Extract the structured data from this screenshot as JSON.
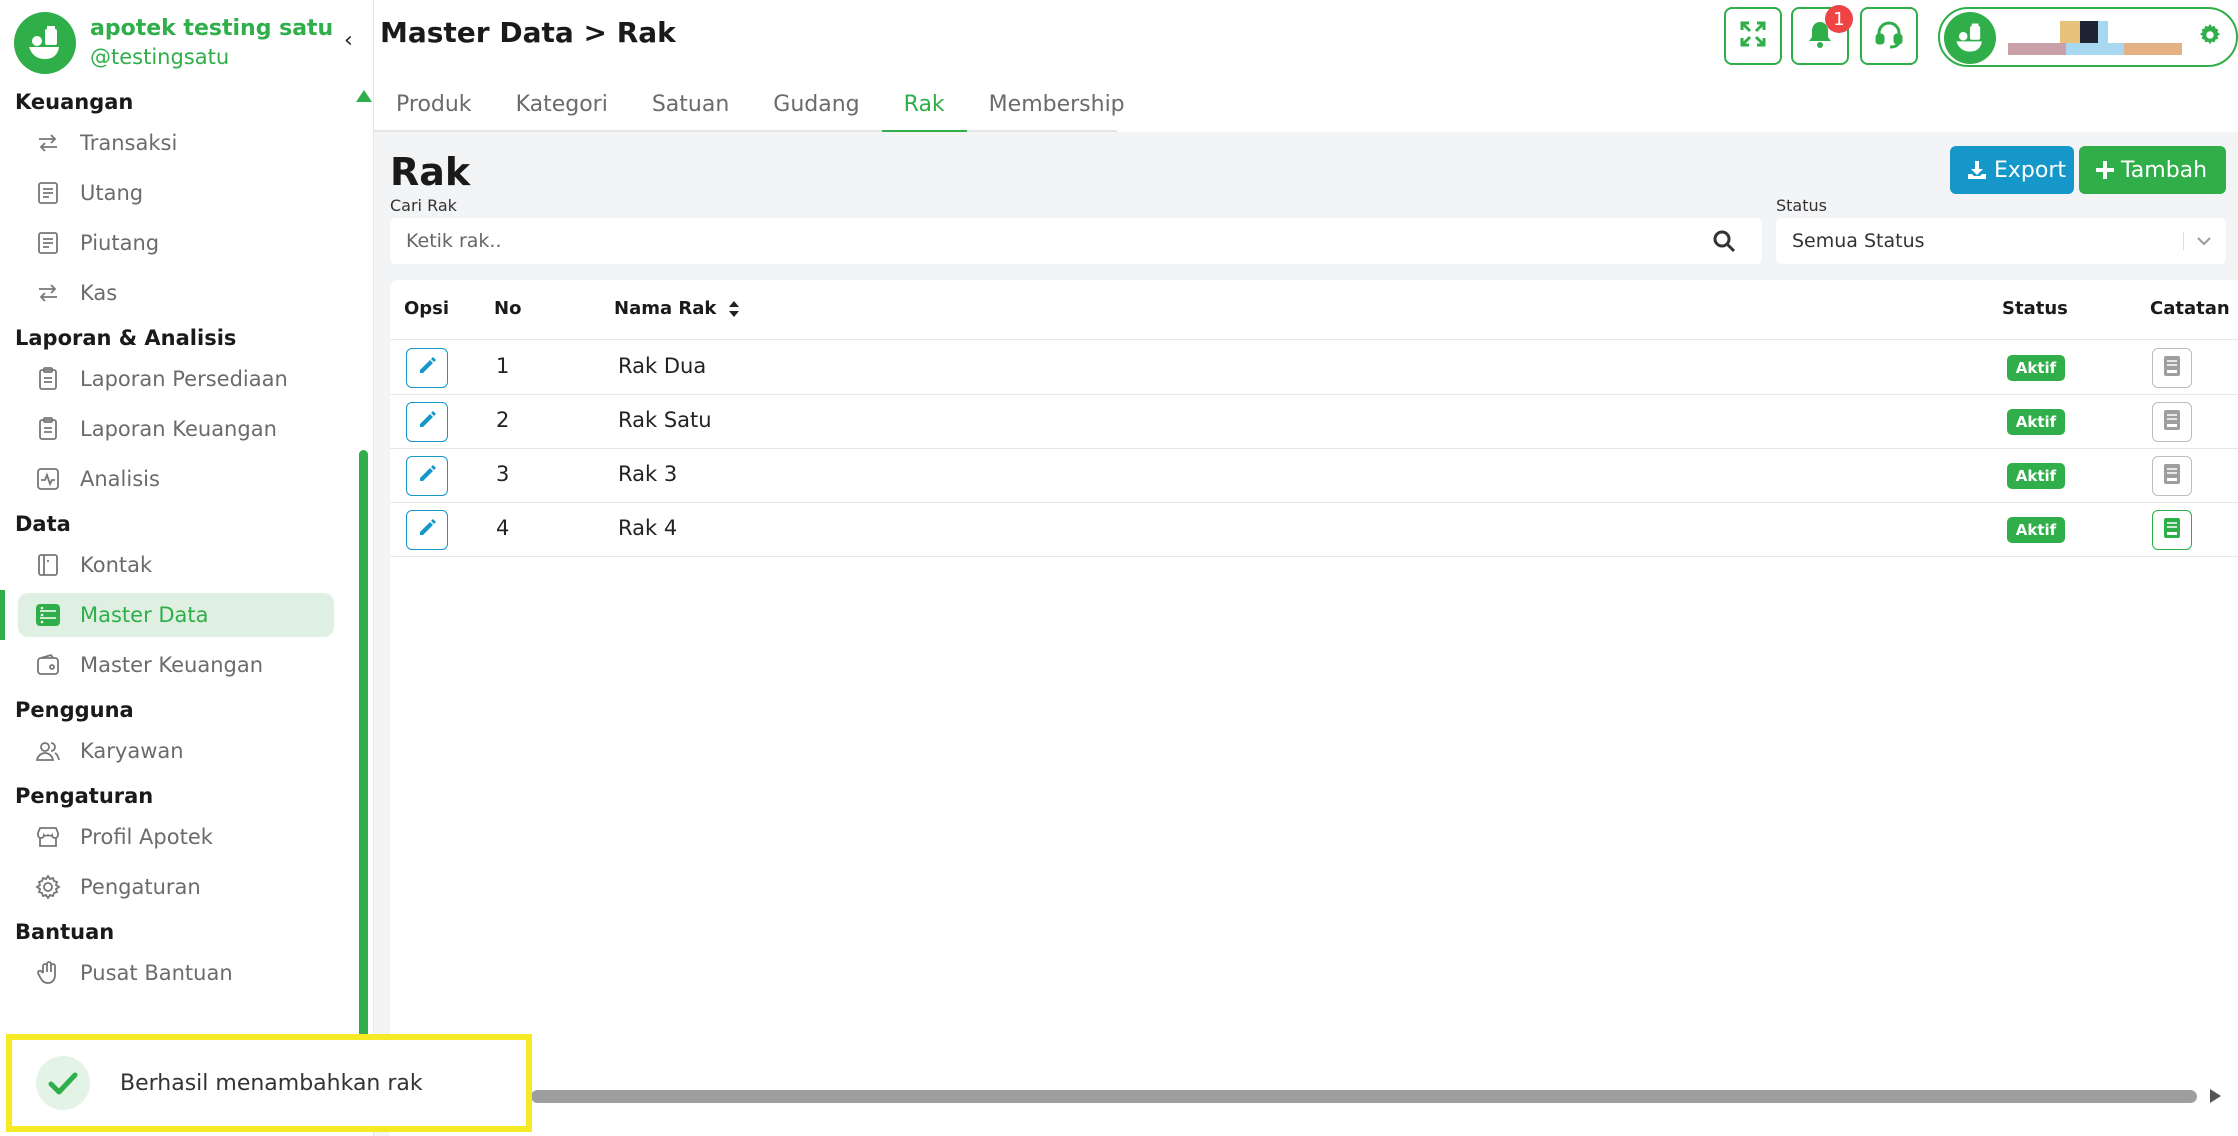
{
  "brand": {
    "name": "apotek testing satu",
    "handle": "@testingsatu"
  },
  "sidebar": {
    "collapse_glyph": "‹",
    "sections": [
      {
        "title": "Keuangan",
        "items": [
          {
            "label": "Transaksi",
            "icon": "transfer-icon"
          },
          {
            "label": "Utang",
            "icon": "receipt-icon"
          },
          {
            "label": "Piutang",
            "icon": "receipt-icon"
          },
          {
            "label": "Kas",
            "icon": "transfer-icon"
          }
        ]
      },
      {
        "title": "Laporan & Analisis",
        "items": [
          {
            "label": "Laporan Persediaan",
            "icon": "clipboard-icon"
          },
          {
            "label": "Laporan Keuangan",
            "icon": "clipboard-icon"
          },
          {
            "label": "Analisis",
            "icon": "activity-icon"
          }
        ]
      },
      {
        "title": "Data",
        "items": [
          {
            "label": "Kontak",
            "icon": "contact-book-icon"
          },
          {
            "label": "Master Data",
            "icon": "server-icon",
            "active": true
          },
          {
            "label": "Master Keuangan",
            "icon": "wallet-icon"
          }
        ]
      },
      {
        "title": "Pengguna",
        "items": [
          {
            "label": "Karyawan",
            "icon": "users-icon"
          }
        ]
      },
      {
        "title": "Pengaturan",
        "items": [
          {
            "label": "Profil Apotek",
            "icon": "store-icon"
          },
          {
            "label": "Pengaturan",
            "icon": "gear-icon"
          }
        ]
      },
      {
        "title": "Bantuan",
        "items": [
          {
            "label": "Pusat Bantuan",
            "icon": "hand-icon"
          }
        ]
      }
    ]
  },
  "header": {
    "title": "Master Data > Rak",
    "notification_count": "1"
  },
  "tabs": [
    {
      "label": "Produk"
    },
    {
      "label": "Kategori"
    },
    {
      "label": "Satuan"
    },
    {
      "label": "Gudang"
    },
    {
      "label": "Rak",
      "active": true
    },
    {
      "label": "Membership"
    }
  ],
  "content": {
    "title": "Rak",
    "export_label": "Export",
    "add_label": "Tambah",
    "search_label": "Cari Rak",
    "search_placeholder": "Ketik rak..",
    "status_label": "Status",
    "status_value": "Semua Status"
  },
  "table": {
    "columns": {
      "opsi": "Opsi",
      "no": "No",
      "nama": "Nama Rak",
      "status": "Status",
      "catatan": "Catatan"
    },
    "rows": [
      {
        "no": "1",
        "nama": "Rak Dua",
        "status": "Aktif",
        "note_filled": false
      },
      {
        "no": "2",
        "nama": "Rak Satu",
        "status": "Aktif",
        "note_filled": false
      },
      {
        "no": "3",
        "nama": "Rak 3",
        "status": "Aktif",
        "note_filled": false
      },
      {
        "no": "4",
        "nama": "Rak 4",
        "status": "Aktif",
        "note_filled": true
      }
    ]
  },
  "toast": {
    "message": "Berhasil menambahkan rak"
  },
  "colors": {
    "primary": "#2fae49",
    "info": "#1597c9",
    "danger": "#ef4444",
    "highlight": "#f5ea23"
  }
}
